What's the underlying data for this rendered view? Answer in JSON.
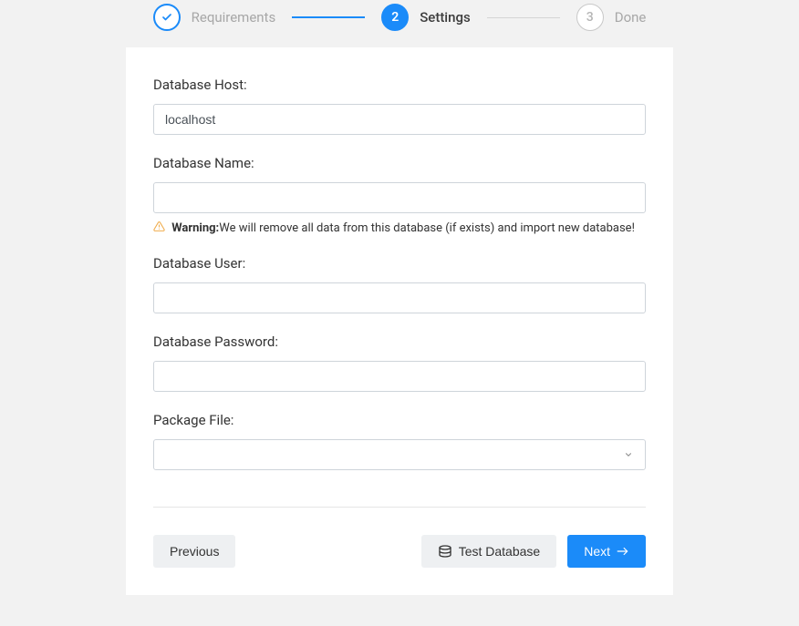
{
  "stepper": {
    "steps": [
      {
        "id": "requirements",
        "label": "Requirements",
        "state": "done"
      },
      {
        "id": "settings",
        "label": "Settings",
        "state": "active",
        "number": "2"
      },
      {
        "id": "done",
        "label": "Done",
        "state": "pending",
        "number": "3"
      }
    ]
  },
  "form": {
    "db_host": {
      "label": "Database Host:",
      "value": "localhost"
    },
    "db_name": {
      "label": "Database Name:",
      "value": "",
      "warning_label": "Warning:",
      "warning_text": "We will remove all data from this database (if exists) and import new database!"
    },
    "db_user": {
      "label": "Database User:",
      "value": ""
    },
    "db_password": {
      "label": "Database Password:",
      "value": ""
    },
    "package_file": {
      "label": "Package File:",
      "selected": ""
    }
  },
  "buttons": {
    "previous": "Previous",
    "test_database": "Test Database",
    "next": "Next"
  }
}
